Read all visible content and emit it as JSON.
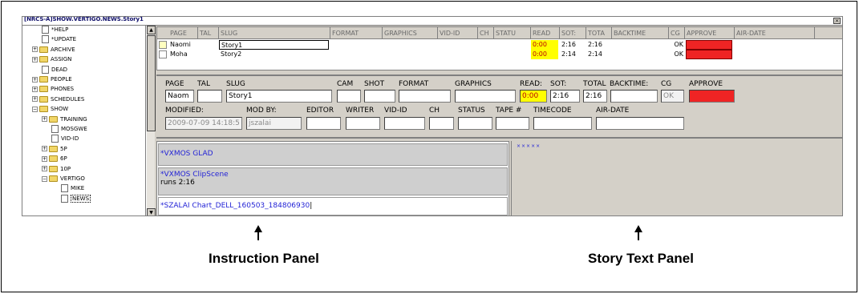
{
  "window": {
    "title": "[NRCS-A]SHOW.VERTIGO.NEWS.Story1",
    "close_glyph": "×"
  },
  "tree": {
    "items": [
      {
        "label": "*HELP",
        "type": "doc",
        "expander": ""
      },
      {
        "label": "*UPDATE",
        "type": "doc",
        "expander": ""
      },
      {
        "label": "ARCHIVE",
        "type": "folder",
        "expander": "+"
      },
      {
        "label": "ASSIGN",
        "type": "folder",
        "expander": "+"
      },
      {
        "label": "DEAD",
        "type": "doc",
        "expander": ""
      },
      {
        "label": "PEOPLE",
        "type": "folder",
        "expander": "+"
      },
      {
        "label": "PHONES",
        "type": "folder",
        "expander": "+"
      },
      {
        "label": "SCHEDULES",
        "type": "folder",
        "expander": "+"
      },
      {
        "label": "SHOW",
        "type": "folder",
        "expander": "−"
      },
      {
        "label": "TRAINING",
        "type": "folder",
        "expander": "+"
      },
      {
        "label": "MOSGWE",
        "type": "doc",
        "expander": ""
      },
      {
        "label": "VID-ID",
        "type": "doc",
        "expander": ""
      },
      {
        "label": "5P",
        "type": "folder",
        "expander": "+"
      },
      {
        "label": "6P",
        "type": "folder",
        "expander": "+"
      },
      {
        "label": "10P",
        "type": "folder",
        "expander": "+"
      },
      {
        "label": "VERTIGO",
        "type": "folder",
        "expander": "−"
      },
      {
        "label": "MIKE",
        "type": "doc",
        "expander": ""
      },
      {
        "label": "NEWS",
        "type": "doc",
        "expander": "",
        "selected": true
      }
    ],
    "scroll_up": "▲",
    "scroll_down": "▼"
  },
  "grid": {
    "headers": [
      "PAGE",
      "TAL",
      "SLUG",
      "FORMAT",
      "GRAPHICS",
      "VID-ID",
      "CH",
      "STATU",
      "READ",
      "SOT:",
      "TOTA",
      "BACKTIME",
      "CG",
      "APPROVE",
      "AIR-DATE"
    ],
    "rows": [
      {
        "page": "Naomi",
        "slug": "Story1",
        "read": "0:00",
        "sot": "2:16",
        "total": "2:16",
        "cg": "OK"
      },
      {
        "page": "Moha",
        "slug": "Story2",
        "read": "0:00",
        "sot": "2:14",
        "total": "2:14",
        "cg": "OK"
      }
    ],
    "colors": {
      "read_highlight": "#ffff00",
      "approve_fill": "#ef2424",
      "row_marker": "#ffffc0"
    }
  },
  "form": {
    "row1_labels": {
      "page": "PAGE",
      "tal": "TAL",
      "slug": "SLUG",
      "cam": "CAM",
      "shot": "SHOT",
      "format": "FORMAT",
      "graphics": "GRAPHICS",
      "read": "READ:",
      "sot": "SOT:",
      "total": "TOTAL",
      "backtime": "BACKTIME:",
      "cg": "CG",
      "approve": "APPROVE"
    },
    "row1_values": {
      "page": "Naom",
      "tal": "",
      "slug": "Story1",
      "cam": "",
      "shot": "",
      "format": "",
      "graphics": "",
      "read": "0:00",
      "sot": "2:16",
      "total": "2:16",
      "backtime": "",
      "cg": "OK"
    },
    "row2_labels": {
      "modified": "MODIFIED:",
      "modby": "MOD BY:",
      "editor": "EDITOR",
      "writer": "WRITER",
      "vidid": "VID-ID",
      "ch": "CH",
      "status": "STATUS",
      "tape": "TAPE #",
      "timecode": "TIMECODE",
      "airdate": "AIR-DATE"
    },
    "row2_values": {
      "modified": "2009-07-09 14:18:5",
      "modby": "jszalai"
    }
  },
  "instructions": {
    "items": [
      {
        "title": "*VXMOS GLAD",
        "sub": ""
      },
      {
        "title": "*VXMOS ClipScene",
        "sub": "runs 2:16"
      },
      {
        "title": "*SZALAI Chart_DELL_160503_184806930",
        "sub": ""
      }
    ]
  },
  "story_text": {
    "marker": "×××××"
  },
  "callouts": {
    "instruction": "Instruction Panel",
    "story": "Story Text Panel"
  }
}
